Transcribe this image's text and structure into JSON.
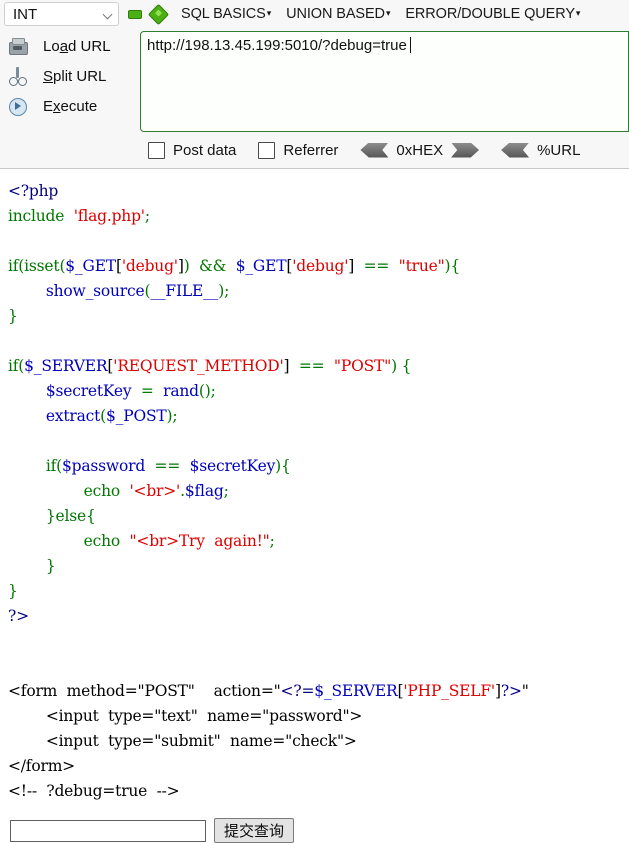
{
  "hackbar": {
    "type_select": {
      "value": "INT",
      "icon": "chevron-down-icon"
    },
    "icons": {
      "minus": "minus-icon",
      "plus": "plus-icon"
    },
    "menus": [
      {
        "label": "SQL BASICS",
        "caret": "▾"
      },
      {
        "label": "UNION BASED",
        "caret": "▾"
      },
      {
        "label": "ERROR/DOUBLE QUERY",
        "caret": "▾"
      }
    ],
    "actions": [
      {
        "label_pre": "Lo",
        "label_key": "a",
        "label_post": "d URL",
        "icon": "printer-icon"
      },
      {
        "label_pre": "",
        "label_key": "S",
        "label_post": "plit URL",
        "icon": "scissors-icon"
      },
      {
        "label_pre": "E",
        "label_key": "x",
        "label_post": "ecute",
        "icon": "play-circle-icon"
      }
    ],
    "url": {
      "value": "http://198.13.45.199:5010/?debug=true",
      "placeholder": ""
    },
    "options": {
      "post_data": {
        "label": "Post data",
        "checked": false
      },
      "referrer": {
        "label": "Referrer",
        "checked": false
      },
      "hex": {
        "label": "0xHEX"
      },
      "url_encode": {
        "label": "%URL"
      }
    },
    "colors": {
      "accent_green": "#4caf14",
      "border_green": "#2f7d2f",
      "panel_bg": "#f7f7f7"
    }
  },
  "source": {
    "lines": [
      [
        {
          "t": "<?php",
          "c": "c-tag"
        }
      ],
      [
        {
          "t": "include",
          "c": "c-kw"
        },
        {
          "t": "  ",
          "c": "c-html"
        },
        {
          "t": "'flag.php'",
          "c": "c-str"
        },
        {
          "t": ";",
          "c": "c-kw"
        }
      ],
      [
        {
          "t": "",
          "c": "c-html"
        }
      ],
      [
        {
          "t": "if",
          "c": "c-kw"
        },
        {
          "t": "(",
          "c": "c-kw"
        },
        {
          "t": "isset",
          "c": "c-kw"
        },
        {
          "t": "(",
          "c": "c-kw"
        },
        {
          "t": "$_GET",
          "c": "c-var"
        },
        {
          "t": "[",
          "c": "c-html"
        },
        {
          "t": "'debug'",
          "c": "c-str"
        },
        {
          "t": "]",
          "c": "c-html"
        },
        {
          "t": ")",
          "c": "c-kw"
        },
        {
          "t": "  ",
          "c": "c-html"
        },
        {
          "t": "&&",
          "c": "c-kw"
        },
        {
          "t": "  ",
          "c": "c-html"
        },
        {
          "t": "$_GET",
          "c": "c-var"
        },
        {
          "t": "[",
          "c": "c-html"
        },
        {
          "t": "'debug'",
          "c": "c-str"
        },
        {
          "t": "]",
          "c": "c-html"
        },
        {
          "t": "  ",
          "c": "c-html"
        },
        {
          "t": "==",
          "c": "c-kw"
        },
        {
          "t": "  ",
          "c": "c-html"
        },
        {
          "t": "\"true\"",
          "c": "c-str"
        },
        {
          "t": ")",
          "c": "c-kw"
        },
        {
          "t": "{",
          "c": "c-kw"
        }
      ],
      [
        {
          "t": "        ",
          "c": "c-html"
        },
        {
          "t": "show_source",
          "c": "c-var"
        },
        {
          "t": "(",
          "c": "c-kw"
        },
        {
          "t": "__FILE__",
          "c": "c-var"
        },
        {
          "t": ")",
          "c": "c-kw"
        },
        {
          "t": ";",
          "c": "c-kw"
        }
      ],
      [
        {
          "t": "}",
          "c": "c-kw"
        }
      ],
      [
        {
          "t": "",
          "c": "c-html"
        }
      ],
      [
        {
          "t": "if",
          "c": "c-kw"
        },
        {
          "t": "(",
          "c": "c-kw"
        },
        {
          "t": "$_SERVER",
          "c": "c-var"
        },
        {
          "t": "[",
          "c": "c-html"
        },
        {
          "t": "'REQUEST_METHOD'",
          "c": "c-str"
        },
        {
          "t": "]",
          "c": "c-html"
        },
        {
          "t": "  ",
          "c": "c-html"
        },
        {
          "t": "==",
          "c": "c-kw"
        },
        {
          "t": "  ",
          "c": "c-html"
        },
        {
          "t": "\"POST\"",
          "c": "c-str"
        },
        {
          "t": ")",
          "c": "c-kw"
        },
        {
          "t": " {",
          "c": "c-kw"
        }
      ],
      [
        {
          "t": "        ",
          "c": "c-html"
        },
        {
          "t": "$secretKey",
          "c": "c-var"
        },
        {
          "t": "  ",
          "c": "c-html"
        },
        {
          "t": "=",
          "c": "c-kw"
        },
        {
          "t": "  ",
          "c": "c-html"
        },
        {
          "t": "rand",
          "c": "c-var"
        },
        {
          "t": "()",
          "c": "c-kw"
        },
        {
          "t": ";",
          "c": "c-kw"
        }
      ],
      [
        {
          "t": "        ",
          "c": "c-html"
        },
        {
          "t": "extract",
          "c": "c-var"
        },
        {
          "t": "(",
          "c": "c-kw"
        },
        {
          "t": "$_POST",
          "c": "c-var"
        },
        {
          "t": ")",
          "c": "c-kw"
        },
        {
          "t": ";",
          "c": "c-kw"
        }
      ],
      [
        {
          "t": "",
          "c": "c-html"
        }
      ],
      [
        {
          "t": "        ",
          "c": "c-html"
        },
        {
          "t": "if",
          "c": "c-kw"
        },
        {
          "t": "(",
          "c": "c-kw"
        },
        {
          "t": "$password",
          "c": "c-var"
        },
        {
          "t": "  ",
          "c": "c-html"
        },
        {
          "t": "==",
          "c": "c-kw"
        },
        {
          "t": "  ",
          "c": "c-html"
        },
        {
          "t": "$secretKey",
          "c": "c-var"
        },
        {
          "t": ")",
          "c": "c-kw"
        },
        {
          "t": "{",
          "c": "c-kw"
        }
      ],
      [
        {
          "t": "                ",
          "c": "c-html"
        },
        {
          "t": "echo",
          "c": "c-kw"
        },
        {
          "t": "  ",
          "c": "c-html"
        },
        {
          "t": "'<br>'",
          "c": "c-str"
        },
        {
          "t": ".",
          "c": "c-kw"
        },
        {
          "t": "$flag",
          "c": "c-var"
        },
        {
          "t": ";",
          "c": "c-kw"
        }
      ],
      [
        {
          "t": "        ",
          "c": "c-html"
        },
        {
          "t": "}",
          "c": "c-kw"
        },
        {
          "t": "else",
          "c": "c-kw"
        },
        {
          "t": "{",
          "c": "c-kw"
        }
      ],
      [
        {
          "t": "                ",
          "c": "c-html"
        },
        {
          "t": "echo",
          "c": "c-kw"
        },
        {
          "t": "  ",
          "c": "c-html"
        },
        {
          "t": "\"<br>Try  again!\"",
          "c": "c-str"
        },
        {
          "t": ";",
          "c": "c-kw"
        }
      ],
      [
        {
          "t": "        ",
          "c": "c-html"
        },
        {
          "t": "}",
          "c": "c-kw"
        }
      ],
      [
        {
          "t": "}",
          "c": "c-kw"
        }
      ],
      [
        {
          "t": "?>",
          "c": "c-tag"
        }
      ],
      [
        {
          "t": "",
          "c": "c-html"
        }
      ],
      [
        {
          "t": "",
          "c": "c-html"
        }
      ],
      [
        {
          "t": "<form  method=\"POST\"    action=\"",
          "c": "c-html"
        },
        {
          "t": "<?=",
          "c": "c-tag"
        },
        {
          "t": "$_SERVER",
          "c": "c-var"
        },
        {
          "t": "[",
          "c": "c-html"
        },
        {
          "t": "'PHP_SELF'",
          "c": "c-str"
        },
        {
          "t": "]",
          "c": "c-html"
        },
        {
          "t": "?>",
          "c": "c-tag"
        },
        {
          "t": "\"",
          "c": "c-html"
        }
      ],
      [
        {
          "t": "        <input  type=\"text\"  name=\"password\">",
          "c": "c-html"
        }
      ],
      [
        {
          "t": "        <input  type=\"submit\"  name=\"check\">",
          "c": "c-html"
        }
      ],
      [
        {
          "t": "</form>",
          "c": "c-html"
        }
      ],
      [
        {
          "t": "<!--  ?debug=true  -->",
          "c": "c-html"
        }
      ]
    ]
  },
  "form": {
    "text_input": {
      "value": "",
      "placeholder": ""
    },
    "submit": {
      "label": "提交查询"
    }
  }
}
